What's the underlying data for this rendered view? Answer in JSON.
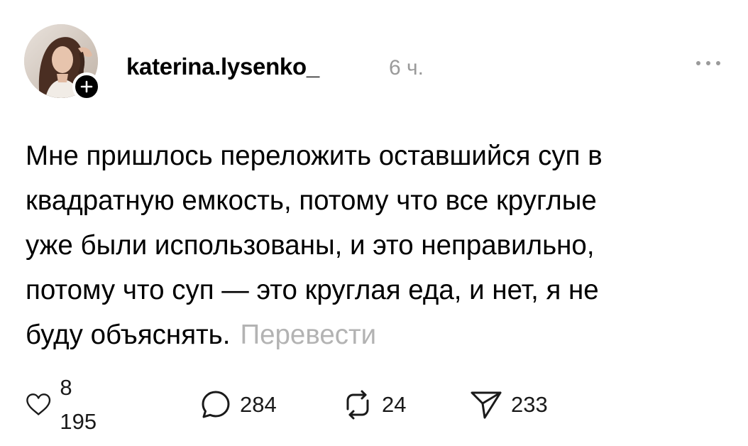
{
  "post": {
    "author": {
      "username": "katerina.lysenko_",
      "avatar_icon": "profile-photo",
      "follow_icon": "plus-icon"
    },
    "timestamp": "6 ч.",
    "menu_icon": "more-horizontal-icon",
    "text_lines": [
      "Мне пришлось переложить оставшийся суп в",
      "квадратную емкость, потому что все круглые",
      "уже были использованы, и это неправильно,",
      "потому что суп — это круглая еда, и нет, я не",
      "буду объяснять."
    ],
    "translate_label": "Перевести",
    "actions": {
      "likes": "8 195",
      "comments": "284",
      "reposts": "24",
      "shares": "233"
    }
  },
  "colors": {
    "text": "#000000",
    "muted": "#9a9a9a",
    "translate": "#b3b3b3",
    "background": "#ffffff"
  }
}
